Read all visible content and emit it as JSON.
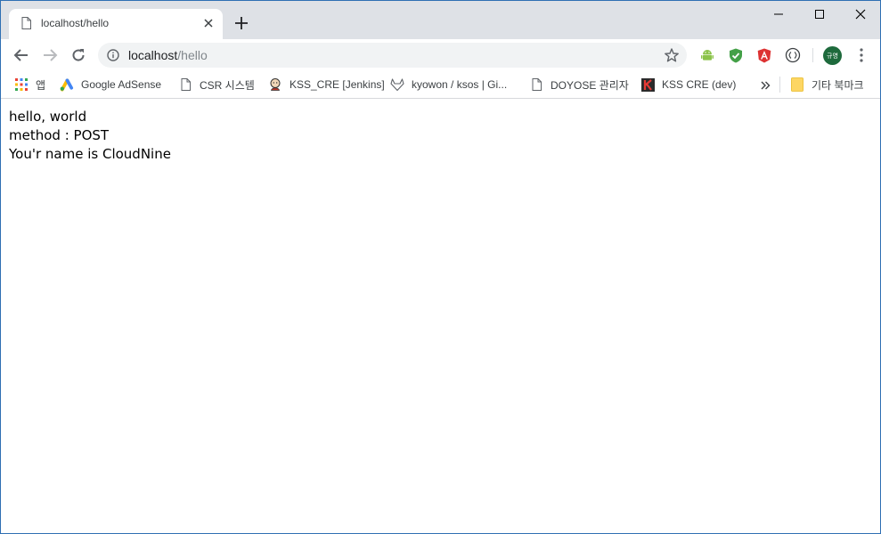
{
  "browser": {
    "tab": {
      "title": "localhost/hello"
    },
    "address_bar": {
      "host": "localhost",
      "path": "/hello"
    },
    "profile": {
      "initials": "규영",
      "color": "#1e6a3c"
    }
  },
  "bookmarks": {
    "items": [
      {
        "label": "앱",
        "icon": "apps-grid-icon"
      },
      {
        "label": "Google AdSense",
        "icon": "adsense-icon"
      },
      {
        "label": "CSR 시스템",
        "icon": "page-icon"
      },
      {
        "label": "KSS_CRE [Jenkins]",
        "icon": "jenkins-icon"
      },
      {
        "label": "kyowon / ksos | Gi...",
        "icon": "gitlab-icon"
      },
      {
        "label": "DOYOSE 관리자",
        "icon": "page-icon"
      },
      {
        "label": "KSS CRE (dev)",
        "icon": "kss-icon"
      }
    ],
    "other_bookmarks": "기타 북마크"
  },
  "page": {
    "lines": [
      "hello, world",
      "method : POST",
      "You'r name is CloudNine"
    ]
  },
  "colors": {
    "frame": "#dee1e6",
    "window_border": "#2f6fb3",
    "omnibox": "#f1f3f4"
  }
}
